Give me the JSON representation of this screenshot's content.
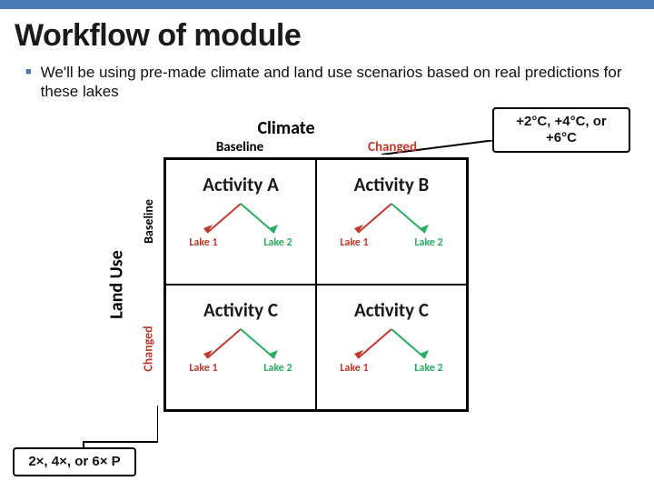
{
  "title": "Workflow of module",
  "bullet": "We'll be using pre-made climate and land use scenarios based on real predictions for these lakes",
  "axes": {
    "climate": "Climate",
    "landuse": "Land Use",
    "col_baseline": "Baseline",
    "col_changed": "Changed",
    "row_baseline": "Baseline",
    "row_changed": "Changed"
  },
  "cells": {
    "a": "Activity A",
    "b": "Activity B",
    "c1": "Activity C",
    "c2": "Activity C"
  },
  "lake1": "Lake 1",
  "lake2": "Lake 2",
  "callouts": {
    "climate": "+2°C, +4°C, or +6°C",
    "landuse": "2×, 4×, or 6× P"
  }
}
